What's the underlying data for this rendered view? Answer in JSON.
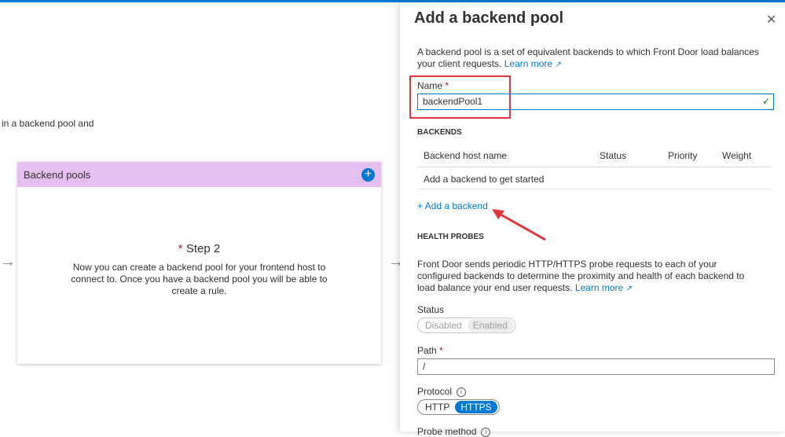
{
  "background": {
    "text_fragment": "in a backend pool and",
    "card": {
      "title": "Backend pools",
      "step_label": "Step 2",
      "step_required": "*",
      "description": "Now you can create a backend pool for your frontend host to connect to. Once you have a backend pool you will be able to create a rule."
    },
    "left_arrow_icon": "→",
    "right_arrow_icon": "→"
  },
  "panel": {
    "title": "Add a backend pool",
    "close_icon": "✕",
    "description": "A backend pool is a set of equivalent backends to which Front Door load balances your client requests.",
    "learn_more": "Learn more",
    "name_label": "Name",
    "required_marker": "*",
    "name_value": "backendPool1",
    "backends_heading": "BACKENDS",
    "table_headers": {
      "host": "Backend host name",
      "status": "Status",
      "priority": "Priority",
      "weight": "Weight"
    },
    "empty_message": "Add a backend to get started",
    "add_backend": "+ Add a backend",
    "health_probes_heading": "HEALTH PROBES",
    "health_description": "Front Door sends periodic HTTP/HTTPS probe requests to each of your configured backends to determine the proximity and health of each backend to load balance your end user requests.",
    "health_learn_more": "Learn more",
    "status_label": "Status",
    "status_options": [
      "Disabled",
      "Enabled"
    ],
    "status_selected": "Enabled",
    "path_label": "Path",
    "path_value": "/",
    "protocol_label": "Protocol",
    "protocol_options": [
      "HTTP",
      "HTTPS"
    ],
    "protocol_selected": "HTTPS",
    "probe_method_label": "Probe method"
  },
  "colors": {
    "accent": "#0078d4",
    "card_header": "#e5bff0",
    "highlight": "#e0353b",
    "required": "#a4262c"
  }
}
